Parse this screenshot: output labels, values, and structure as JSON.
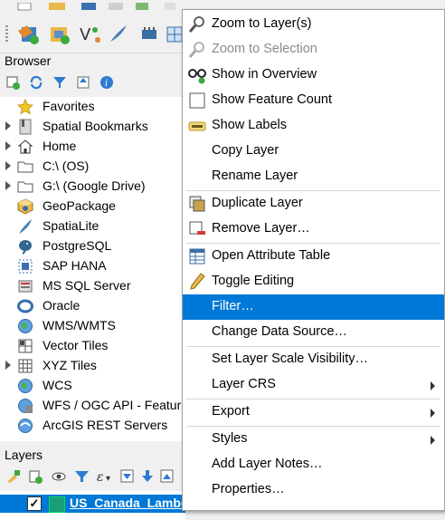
{
  "browser": {
    "title": "Browser",
    "items": [
      {
        "label": "Favorites",
        "icon": "star-icon",
        "expandable": false
      },
      {
        "label": "Spatial Bookmarks",
        "icon": "bookmark-icon",
        "expandable": true
      },
      {
        "label": "Home",
        "icon": "home-icon",
        "expandable": true
      },
      {
        "label": "C:\\ (OS)",
        "icon": "folder-icon",
        "expandable": true
      },
      {
        "label": "G:\\ (Google Drive)",
        "icon": "folder-icon",
        "expandable": true
      },
      {
        "label": "GeoPackage",
        "icon": "geopackage-icon",
        "expandable": false
      },
      {
        "label": "SpatiaLite",
        "icon": "feather-icon",
        "expandable": false
      },
      {
        "label": "PostgreSQL",
        "icon": "elephant-icon",
        "expandable": false
      },
      {
        "label": "SAP HANA",
        "icon": "hana-icon",
        "expandable": false
      },
      {
        "label": "MS SQL Server",
        "icon": "mssql-icon",
        "expandable": false
      },
      {
        "label": "Oracle",
        "icon": "oracle-icon",
        "expandable": false
      },
      {
        "label": "WMS/WMTS",
        "icon": "globe-icon",
        "expandable": false
      },
      {
        "label": "Vector Tiles",
        "icon": "tiles-icon",
        "expandable": false
      },
      {
        "label": "XYZ Tiles",
        "icon": "grid-icon",
        "expandable": true
      },
      {
        "label": "WCS",
        "icon": "globe-icon",
        "expandable": false
      },
      {
        "label": "WFS / OGC API - Featur",
        "icon": "wfs-icon",
        "expandable": false
      },
      {
        "label": "ArcGIS REST Servers",
        "icon": "arcgis-icon",
        "expandable": false
      }
    ]
  },
  "layers": {
    "title": "Layers",
    "selected_layer": {
      "name": "US_Canada_Lambert",
      "checked": "✓"
    }
  },
  "context_menu": {
    "items": [
      {
        "label": "Zoom to Layer(s)",
        "icon": "zoom-icon",
        "disabled": false
      },
      {
        "label": "Zoom to Selection",
        "icon": "zoom-selection-icon",
        "disabled": true
      },
      {
        "label": "Show in Overview",
        "icon": "glasses-icon",
        "disabled": false
      },
      {
        "label": "Show Feature Count",
        "icon": "checkbox-icon",
        "disabled": false
      },
      {
        "label": "Show Labels",
        "icon": "labels-icon",
        "disabled": false
      },
      {
        "label": "Copy Layer",
        "icon": "",
        "disabled": false
      },
      {
        "label": "Rename Layer",
        "icon": "",
        "disabled": false
      },
      {
        "label": "Duplicate Layer",
        "icon": "duplicate-icon",
        "disabled": false
      },
      {
        "label": "Remove Layer…",
        "icon": "remove-icon",
        "disabled": false
      },
      {
        "label": "Open Attribute Table",
        "icon": "table-icon",
        "disabled": false
      },
      {
        "label": "Toggle Editing",
        "icon": "pencil-icon",
        "disabled": false
      },
      {
        "label": "Filter…",
        "icon": "",
        "disabled": false,
        "highlighted": true
      },
      {
        "label": "Change Data Source…",
        "icon": "",
        "disabled": false
      },
      {
        "label": "Set Layer Scale Visibility…",
        "icon": "",
        "disabled": false
      },
      {
        "label": "Layer CRS",
        "icon": "",
        "disabled": false,
        "submenu": true
      },
      {
        "label": "Export",
        "icon": "",
        "disabled": false,
        "submenu": true
      },
      {
        "label": "Styles",
        "icon": "",
        "disabled": false,
        "submenu": true
      },
      {
        "label": "Add Layer Notes…",
        "icon": "",
        "disabled": false
      },
      {
        "label": "Properties…",
        "icon": "",
        "disabled": false
      }
    ]
  },
  "colors": {
    "highlight": "#0078d7",
    "layer_swatch": "#1a9e7a"
  }
}
